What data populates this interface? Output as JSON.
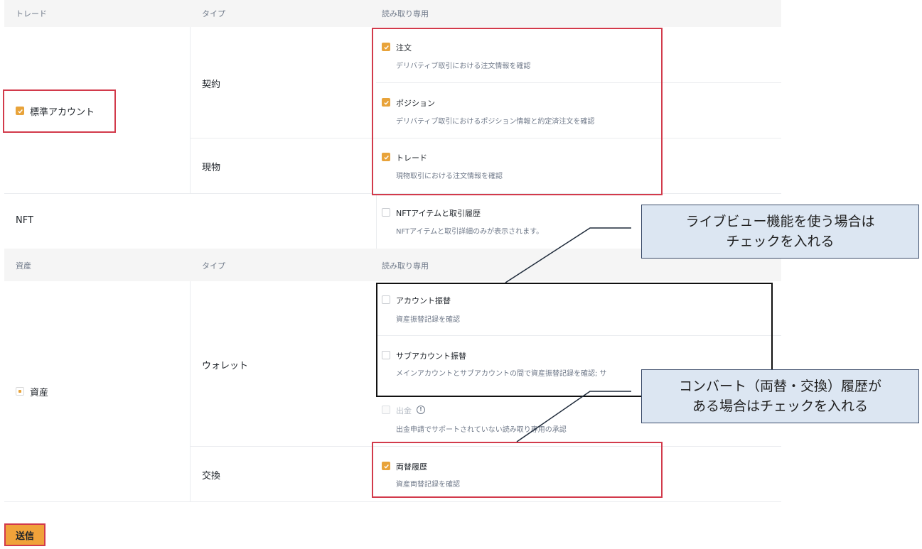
{
  "trade_header": {
    "col1": "トレード",
    "col2": "タイプ",
    "col3": "読み取り専用"
  },
  "standard_account": {
    "label": "標準アカウント",
    "types": {
      "contract": "契約",
      "spot": "現物"
    },
    "perms": [
      {
        "name": "注文",
        "desc": "デリバティブ取引における注文情報を確認",
        "checked": true
      },
      {
        "name": "ポジション",
        "desc": "デリバティブ取引におけるポジション情報と約定済注文を確認",
        "checked": true
      },
      {
        "name": "トレード",
        "desc": "現物取引における注文情報を確認",
        "checked": true
      }
    ]
  },
  "nft": {
    "label": "NFT",
    "perm": {
      "name": "NFTアイテムと取引履歴",
      "desc": "NFTアイテムと取引詳細のみが表示されます。",
      "checked": false
    }
  },
  "asset_header": {
    "col1": "資産",
    "col2": "タイプ",
    "col3": "読み取り専用"
  },
  "asset": {
    "label": "資産",
    "types": {
      "wallet": "ウォレット",
      "exchange": "交換"
    },
    "perms": [
      {
        "name": "アカウント振替",
        "desc": "資産振替記録を確認",
        "checked": false
      },
      {
        "name": "サブアカウント振替",
        "desc": "メインアカウントとサブアカウントの間で資産振替記録を確認; サ",
        "checked": false
      },
      {
        "name": "出金",
        "desc": "出金申請でサポートされていない読み取り専用の承認",
        "checked": false,
        "disabled": true
      },
      {
        "name": "両替履歴",
        "desc": "資産両替記録を確認",
        "checked": true
      }
    ]
  },
  "callouts": {
    "live_view": {
      "line1": "ライブビュー機能を使う場合は",
      "line2": "チェックを入れる"
    },
    "convert": {
      "line1": "コンバート（両替・交換）履歴が",
      "line2": "ある場合はチェックを入れる"
    }
  },
  "submit_label": "送信",
  "colors": {
    "accent": "#e8a33a",
    "highlight_red": "#d23a4b",
    "callout_bg": "#dce6f2"
  }
}
